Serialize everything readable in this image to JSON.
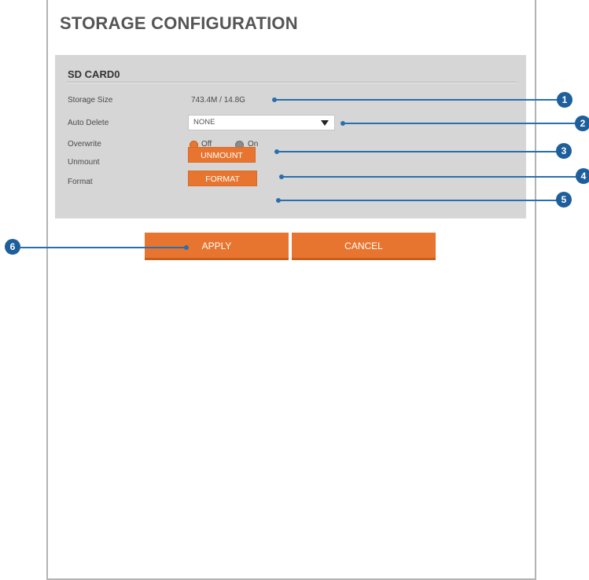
{
  "page": {
    "title": "STORAGE CONFIGURATION"
  },
  "sd_card": {
    "title": "SD CARD0",
    "storage_size": {
      "label": "Storage Size",
      "value": "743.4M / 14.8G"
    },
    "auto_delete": {
      "label": "Auto Delete",
      "value": "NONE"
    },
    "overwrite": {
      "label": "Overwrite",
      "options": [
        "Off",
        "On"
      ],
      "selected": "Off"
    },
    "unmount": {
      "label": "Unmount",
      "button": "UNMOUNT"
    },
    "format": {
      "label": "Format",
      "button": "FORMAT"
    }
  },
  "actions": {
    "apply": "APPLY",
    "cancel": "CANCEL"
  },
  "callouts": [
    "1",
    "2",
    "3",
    "4",
    "5",
    "6"
  ],
  "colors": {
    "accent": "#e8752f",
    "callout": "#1e5f9b",
    "panel": "#d6d6d6"
  }
}
